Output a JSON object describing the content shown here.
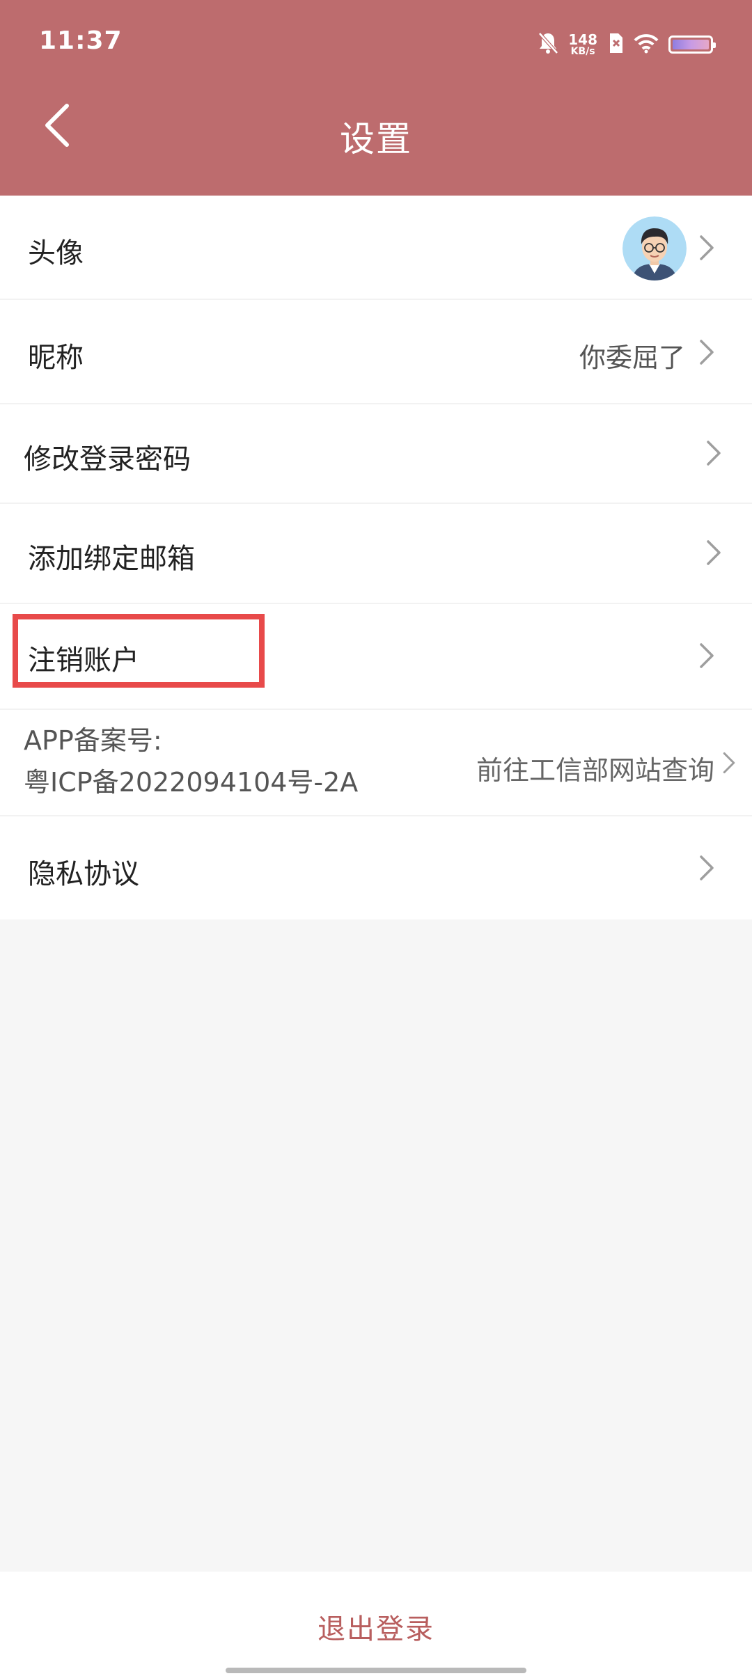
{
  "status_bar": {
    "time": "11:37",
    "net_speed_value": "148",
    "net_speed_unit": "KB/s",
    "icons": [
      "bell-off-icon",
      "sim-x-icon",
      "wifi-icon",
      "battery-icon"
    ]
  },
  "header": {
    "title": "设置",
    "back_icon": "chevron-left-icon",
    "background_color": "#bd6c6e"
  },
  "settings": {
    "avatar": {
      "label": "头像"
    },
    "nickname": {
      "label": "昵称",
      "value": "你委屈了"
    },
    "change_password": {
      "label": "修改登录密码"
    },
    "bind_email": {
      "label": "添加绑定邮箱"
    },
    "cancel_account": {
      "label": "注销账户"
    },
    "beian": {
      "line1": "APP备案号:",
      "line2": "粤ICP备2022094104号-2A",
      "link": "前往工信部网站查询"
    },
    "privacy": {
      "label": "隐私协议"
    }
  },
  "footer": {
    "logout_label": "退出登录",
    "accent_color": "#b85e5e"
  },
  "highlight_color": "#e84a4a"
}
